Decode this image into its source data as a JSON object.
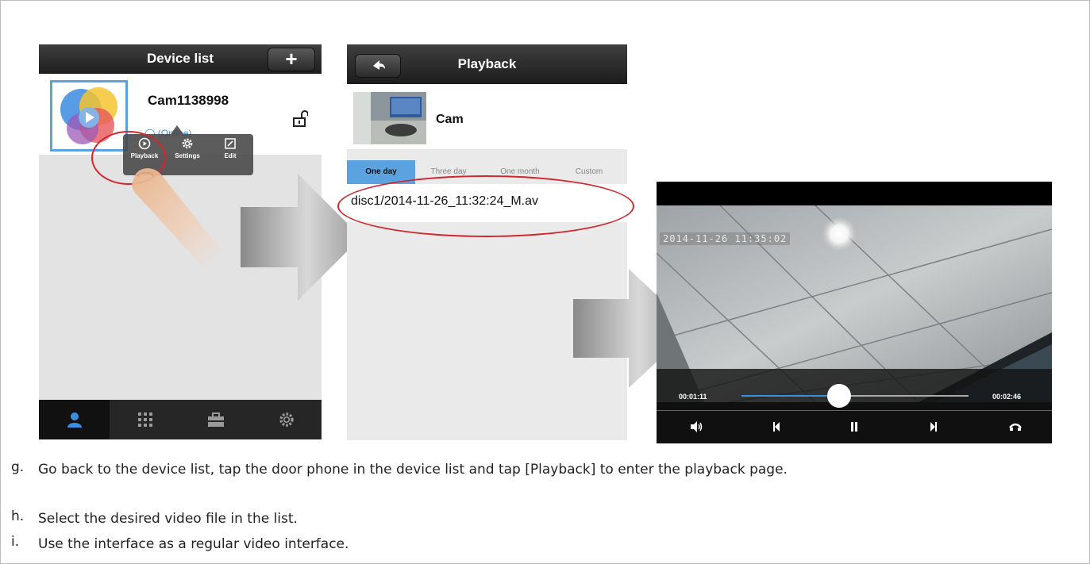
{
  "device_list": {
    "title": "Device list",
    "add_label": "+",
    "camera_name": "Cam1138998",
    "status": "(Online)",
    "popup": [
      {
        "label": "Playback",
        "icon": "play-circle-icon"
      },
      {
        "label": "Settings",
        "icon": "gear-icon"
      },
      {
        "label": "Edit",
        "icon": "edit-icon"
      }
    ],
    "tabs": [
      "user-icon",
      "grid-icon",
      "toolbox-icon",
      "gear-icon"
    ],
    "active_tab": 0,
    "accent": "#5aa3e0",
    "highlight": "#d0282f"
  },
  "playback": {
    "title": "Playback",
    "camera_name": "Cam",
    "tabs": [
      "One day",
      "Three day",
      "One month",
      "Custom"
    ],
    "active_tab": 0,
    "files": [
      "disc1/2014-11-26_11:32:24_M.av"
    ]
  },
  "player": {
    "timestamp": "2014-11-26  11:35:02",
    "current_time": "00:01:11",
    "total_time": "00:02:46",
    "progress": 0.43,
    "controls": [
      "volume-icon",
      "previous-icon",
      "pause-icon",
      "next-icon",
      "exit-icon"
    ]
  },
  "steps": [
    {
      "mark": "g.",
      "text": "Go back to the device list, tap the door phone in the device list and tap [Playback] to enter the playback page."
    },
    {
      "mark": "h.",
      "text": "Select the desired video file in the list."
    },
    {
      "mark": "i.",
      "text": "Use the interface as a regular video interface."
    }
  ]
}
